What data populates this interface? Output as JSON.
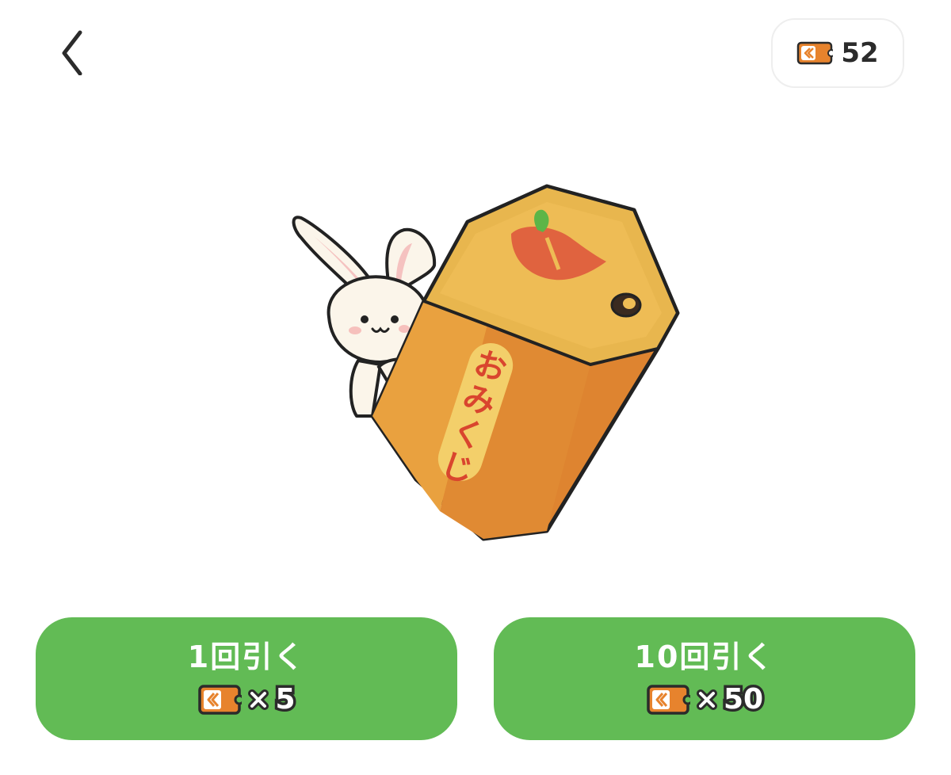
{
  "header": {
    "back_icon": "chevron-left-icon",
    "ticket_icon": "ticket-icon",
    "ticket_balance": "52"
  },
  "illustration": {
    "name": "rabbit-with-omikuji-box",
    "box_text": "おみくじ",
    "colors": {
      "box_top": "#E8B64E",
      "box_side": "#DE8430",
      "box_front": "#E9A13F",
      "apple": "#E0633F",
      "leaf": "#5CB547",
      "outline": "#222222",
      "rabbit": "#FBF5EA"
    }
  },
  "actions": [
    {
      "label": "1回引く",
      "cost_icon": "ticket-icon",
      "multiplier": "×",
      "cost": "5"
    },
    {
      "label": "10回引く",
      "cost_icon": "ticket-icon",
      "multiplier": "×",
      "cost": "50"
    }
  ],
  "colors": {
    "button_bg": "#62BB55",
    "ticket_orange": "#E7832D",
    "text_dark": "#2B2B2B"
  }
}
